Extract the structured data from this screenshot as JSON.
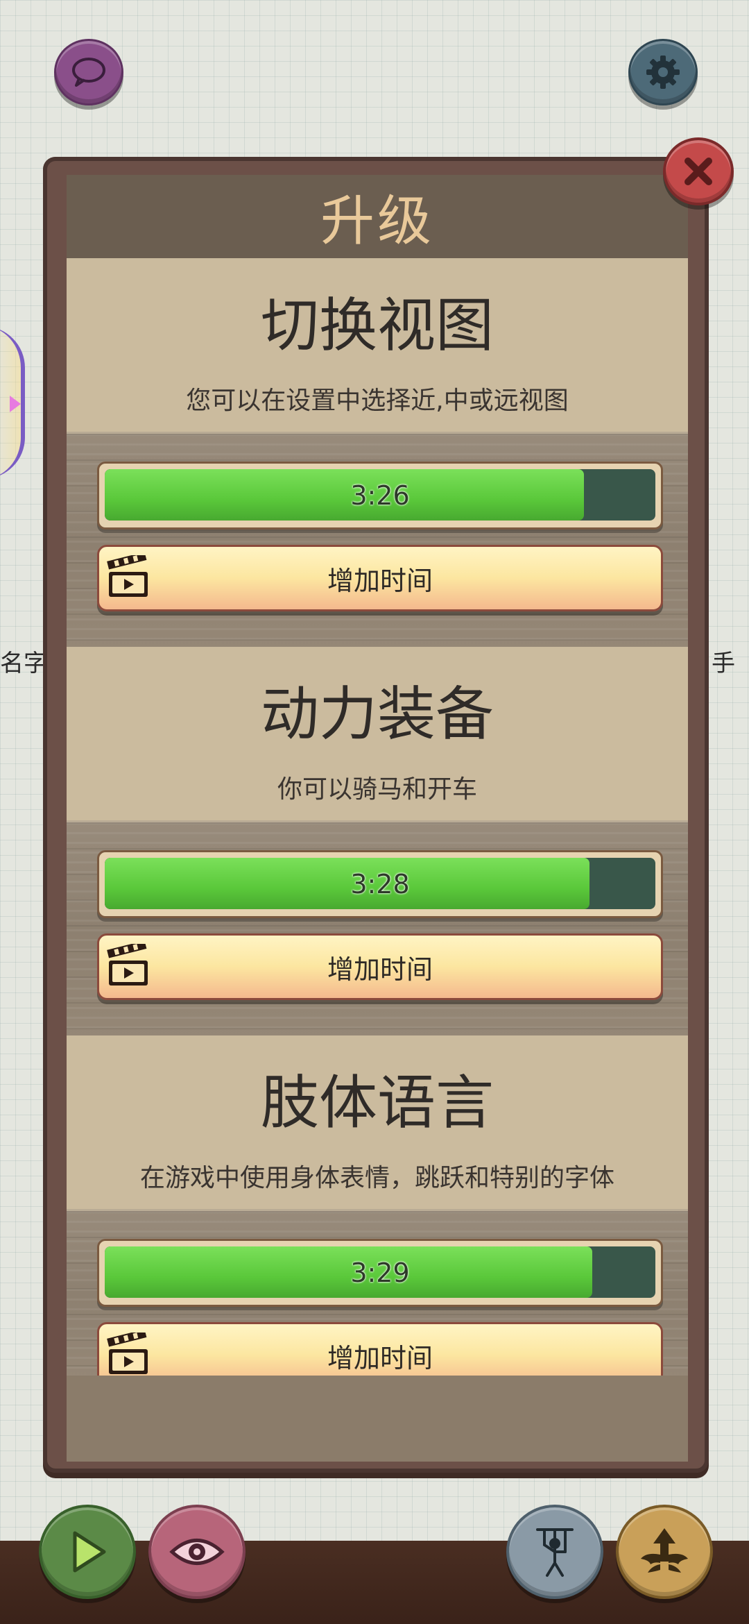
{
  "dialog": {
    "title": "升级",
    "features": [
      {
        "title": "切换视图",
        "description": "您可以在设置中选择近,中或远视图",
        "timer": "3:26",
        "progress": 0.87,
        "button_label": "增加时间"
      },
      {
        "title": "动力装备",
        "description": "你可以骑马和开车",
        "timer": "3:28",
        "progress": 0.88,
        "button_label": "增加时间"
      },
      {
        "title": "肢体语言",
        "description": "在游戏中使用身体表情，跳跃和特别的字体",
        "timer": "3:29",
        "progress": 0.885,
        "button_label": "增加时间"
      }
    ]
  },
  "background": {
    "left_text": "名字",
    "right_text": "手"
  },
  "icons": {
    "chat": "chat-bubble-icon",
    "settings": "gear-icon",
    "close": "close-icon",
    "video": "clapperboard-icon",
    "play": "play-icon",
    "eye": "eye-icon",
    "puppet": "puppet-icon",
    "upgrade": "winged-arrow-up-icon"
  },
  "colors": {
    "progress_fill": "#5ac83a",
    "progress_track": "#39574a",
    "title": "#e9c99a"
  }
}
